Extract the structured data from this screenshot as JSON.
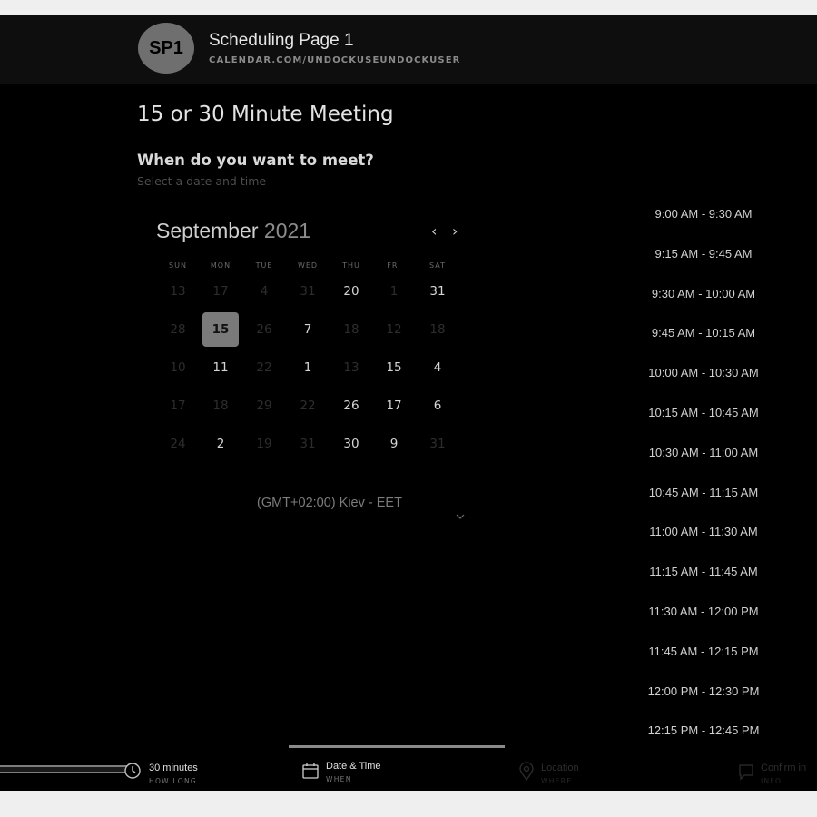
{
  "header": {
    "avatar_initials": "SP1",
    "title": "Scheduling Page 1",
    "url": "CALENDAR.COM/UNDOCKUSEUNDOCKUSER"
  },
  "meeting_title": "15 or 30 Minute Meeting",
  "question": {
    "title": "When do you want to meet?",
    "subtitle": "Select a date and time"
  },
  "calendar": {
    "month": "September",
    "year": "2021",
    "prev_label": "‹",
    "next_label": "›",
    "weekdays": [
      "SUN",
      "MON",
      "TUE",
      "WED",
      "THU",
      "FRI",
      "SAT"
    ],
    "weeks": [
      [
        {
          "d": "13",
          "m": true
        },
        {
          "d": "17",
          "m": true
        },
        {
          "d": "4",
          "m": true
        },
        {
          "d": "31",
          "m": true
        },
        {
          "d": "20",
          "m": false
        },
        {
          "d": "1",
          "m": true
        },
        {
          "d": "31",
          "m": false
        }
      ],
      [
        {
          "d": "28",
          "m": true
        },
        {
          "d": "15",
          "m": false,
          "sel": true
        },
        {
          "d": "26",
          "m": true
        },
        {
          "d": "7",
          "m": false
        },
        {
          "d": "18",
          "m": true
        },
        {
          "d": "12",
          "m": true
        },
        {
          "d": "18",
          "m": true
        }
      ],
      [
        {
          "d": "10",
          "m": true
        },
        {
          "d": "11",
          "m": false
        },
        {
          "d": "22",
          "m": true
        },
        {
          "d": "1",
          "m": false
        },
        {
          "d": "13",
          "m": true
        },
        {
          "d": "15",
          "m": false
        },
        {
          "d": "4",
          "m": false
        }
      ],
      [
        {
          "d": "17",
          "m": true
        },
        {
          "d": "18",
          "m": true
        },
        {
          "d": "29",
          "m": true
        },
        {
          "d": "22",
          "m": true
        },
        {
          "d": "26",
          "m": false
        },
        {
          "d": "17",
          "m": false
        },
        {
          "d": "6",
          "m": false
        }
      ],
      [
        {
          "d": "24",
          "m": true
        },
        {
          "d": "2",
          "m": false
        },
        {
          "d": "19",
          "m": true
        },
        {
          "d": "31",
          "m": true
        },
        {
          "d": "30",
          "m": false
        },
        {
          "d": "9",
          "m": false
        },
        {
          "d": "31",
          "m": true
        }
      ]
    ],
    "timezone": "(GMT+02:00) Kiev - EET"
  },
  "time_slots": [
    "9:00 AM - 9:30 AM",
    "9:15 AM - 9:45 AM",
    "9:30 AM - 10:00 AM",
    "9:45 AM - 10:15 AM",
    "10:00 AM - 10:30 AM",
    "10:15 AM - 10:45 AM",
    "10:30 AM - 11:00 AM",
    "10:45 AM - 11:15 AM",
    "11:00 AM - 11:30 AM",
    "11:15 AM - 11:45 AM",
    "11:30 AM - 12:00 PM",
    "11:45 AM - 12:15 PM",
    "12:00 PM - 12:30 PM",
    "12:15 PM - 12:45 PM"
  ],
  "steps": [
    {
      "label": "30 minutes",
      "sub": "HOW LONG",
      "state": "done",
      "icon": "clock-icon"
    },
    {
      "label": "Date & Time",
      "sub": "WHEN",
      "state": "active",
      "icon": "calendar-icon"
    },
    {
      "label": "Location",
      "sub": "WHERE",
      "state": "pending",
      "icon": "location-pin-icon"
    },
    {
      "label": "Confirm in",
      "sub": "INFO",
      "state": "pending",
      "icon": "chat-icon"
    }
  ],
  "colors": {
    "background": "#000000",
    "header": "#0e0e0e",
    "selected_day": "#7a7a7a",
    "avatar": "#6f6f6f"
  }
}
